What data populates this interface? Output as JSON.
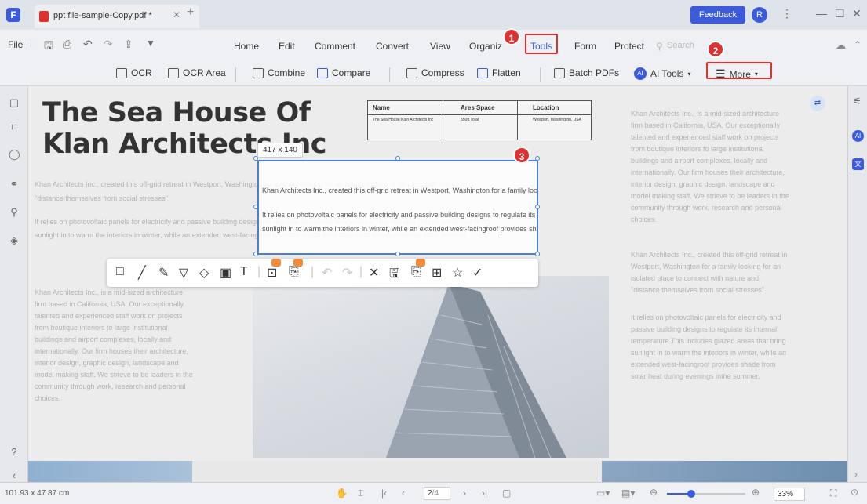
{
  "titlebar": {
    "tab_name": "ppt file-sample-Copy.pdf *",
    "feedback": "Feedback",
    "avatar": "R"
  },
  "menu": {
    "file": "File",
    "items": [
      "Home",
      "Edit",
      "Comment",
      "Convert",
      "View",
      "Organiz",
      "Tools",
      "Form",
      "Protect"
    ],
    "search": "Search"
  },
  "toolbar": {
    "ocr": "OCR",
    "ocr_area": "OCR Area",
    "combine": "Combine",
    "compare": "Compare",
    "compress": "Compress",
    "flatten": "Flatten",
    "batch": "Batch PDFs",
    "ai_tools": "AI Tools",
    "more": "More"
  },
  "badges": [
    "1",
    "2",
    "3"
  ],
  "document": {
    "title_line1": "The Sea House Of",
    "title_line2": "Klan Architects Inc",
    "table_headers": [
      "Name",
      "Ares Space",
      "Location"
    ],
    "table_cells": [
      "The Sea House Klan Architects Inc",
      "550ft Total",
      "Westport, Washington, USA"
    ],
    "para1_line1": "Khan Architects Inc., created this off-grid retreat in Westport, Washington for a family looking for an isolated place to connect with nature and",
    "para1_line2": "\"distance themselves from social stresses\".",
    "para2_line1": "It relies on photovoltaic panels for electricity and passive building designs to regulate its internal temperature.This includes glazed areas that bring",
    "para2_line2": "sunlight in to warm the interiors in winter, while an extended west-facingroof provides shade from solar heat during evenings inthe summer.",
    "right_col1": [
      "Khan Architects Inc., is a mid-sized architecture",
      "firm based in California, USA. Our exceptionally",
      "talented and experienced staff work on projects",
      "from boutique interiors to large institutional",
      "buildings and airport complexes, locally and",
      "internationally. Our firm houses their architecture,",
      "interior design, graphic design, landscape and",
      "model making staff. We strieve to be leaders in the",
      "community through work, research and personal",
      "choices."
    ],
    "right_col2": [
      "Khan Architects Inc., created this off-grid retreat in",
      "Westport, Washington for a family looking for an",
      "isolated place to connect with nature and",
      "\"distance themselves from social stresses\"."
    ],
    "right_col3": [
      "It relies on photovoltaic panels for electricity and",
      "passive building designs to regulate its internal",
      "temperature.This includes glazed areas that bring",
      "sunlight in to warm the interiors in winter, while an",
      "extended west-facingroof provides shade from",
      "solar heat during evenings inthe summer."
    ],
    "left_col": [
      "Khan Architects Inc., is a mid-sized architecture",
      "firm based in California, USA. Our exceptionally",
      "talented and experienced staff work on projects",
      "from boutique interiors to large institutional",
      "buildings and airport complexes, locally and",
      "internationally. Our firm houses their architecture,",
      "interior design, graphic design, landscape and",
      "model making staff. We strieve to be leaders in the",
      "community through work, research and personal",
      "choices."
    ]
  },
  "selection": {
    "size_label": "417 x 140"
  },
  "status": {
    "dimensions": "101.93 x 47.87 cm",
    "page": "2",
    "page_total": "/4",
    "zoom": "33%"
  },
  "colors": {
    "accent": "#3b5bdb",
    "badge": "#e03131",
    "selection": "#4a7fd4"
  }
}
